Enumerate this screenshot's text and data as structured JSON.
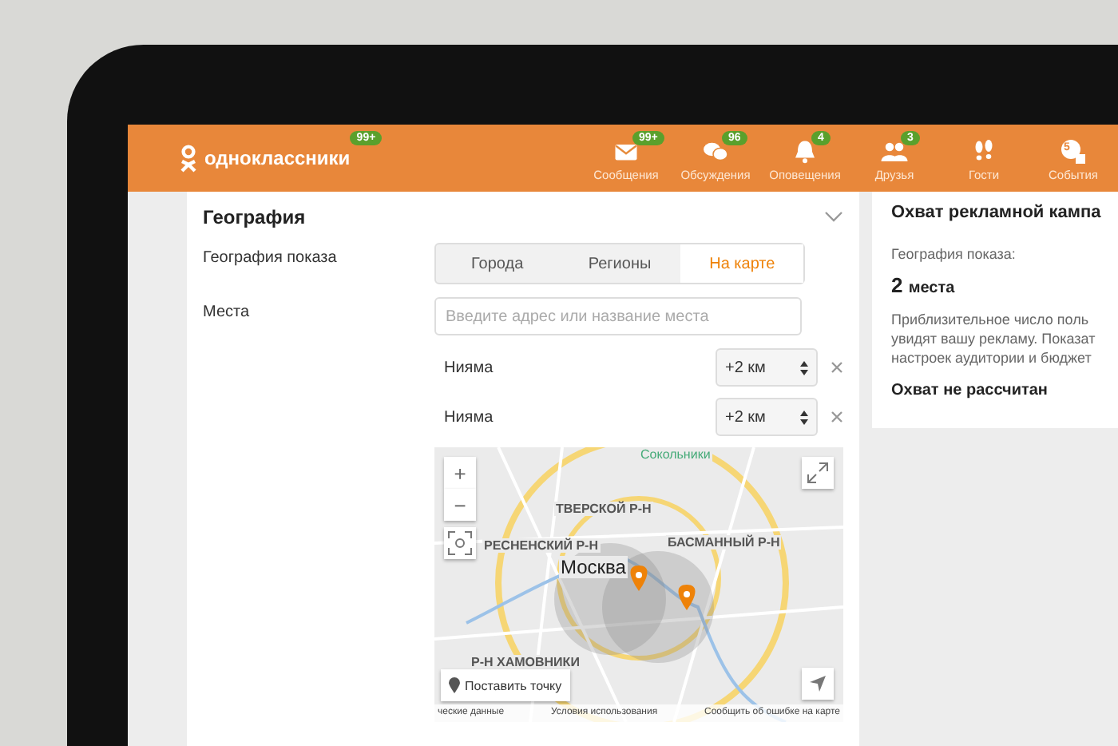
{
  "header": {
    "logo": "одноклассники",
    "logo_badge": "99+",
    "nav": [
      {
        "kind": "mail",
        "label": "Сообщения",
        "badge": "99+"
      },
      {
        "kind": "chat",
        "label": "Обсуждения",
        "badge": "96"
      },
      {
        "kind": "bell",
        "label": "Оповещения",
        "badge": "4"
      },
      {
        "kind": "friends",
        "label": "Друзья",
        "badge": "3"
      },
      {
        "kind": "guests",
        "label": "Гости"
      },
      {
        "kind": "events",
        "label": "События",
        "icon_text": "5"
      }
    ]
  },
  "geography": {
    "title": "География",
    "display_label": "География показа",
    "modes": [
      {
        "label": "Города",
        "selected": false
      },
      {
        "label": "Регионы",
        "selected": false
      },
      {
        "label": "На карте",
        "selected": true
      }
    ],
    "places_label": "Места",
    "search": {
      "placeholder": "Введите адрес или название места"
    },
    "places": [
      {
        "name": "Нияма",
        "radius": "+2 км"
      },
      {
        "name": "Нияма",
        "radius": "+2 км"
      }
    ],
    "map": {
      "labels": [
        {
          "text": "Сокольники",
          "kind": "district"
        },
        {
          "text": "ТВЕРСКОЙ Р-Н",
          "kind": "area"
        },
        {
          "text": "РЕСНЕНСКИЙ Р-Н",
          "kind": "area"
        },
        {
          "text": "БАСМАННЫЙ Р-Н",
          "kind": "area"
        },
        {
          "text": "Москва",
          "kind": "city"
        },
        {
          "text": "Р-Н ХАМОВНИКИ",
          "kind": "area"
        }
      ],
      "zoom_in": "+",
      "zoom_out": "−",
      "place_button": "Поставить точку",
      "footer": [
        "ческие данные",
        "Условия использования",
        "Сообщить об ошибке на карте"
      ]
    }
  },
  "reach": {
    "title": "Охват рекламной кампа",
    "display_label": "География показа:",
    "count": "2",
    "count_unit": "места",
    "description_lines": [
      "Приблизительное число поль",
      "увидят вашу рекламу. Показат",
      "настроек аудитории и бюджет"
    ],
    "status": "Охват не рассчитан"
  }
}
